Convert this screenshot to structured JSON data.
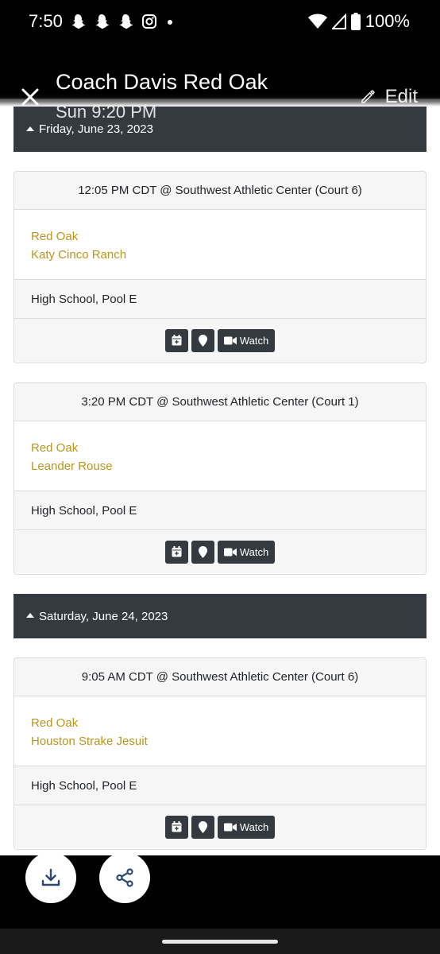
{
  "status_bar": {
    "time": "7:50",
    "battery": "100%"
  },
  "app_bar": {
    "title": "Coach Davis Red Oak",
    "subtitle": "Sun 9:20 PM",
    "edit_label": "Edit"
  },
  "days": [
    {
      "label": "Friday, June 23, 2023",
      "games": [
        {
          "time_location": "12:05 PM CDT @ Southwest Athletic Center (Court 6)",
          "team1": "Red Oak",
          "team2": "Katy Cinco Ranch",
          "division": "High School, Pool E",
          "watch_label": "Watch"
        },
        {
          "time_location": "3:20 PM CDT @ Southwest Athletic Center (Court 1)",
          "team1": "Red Oak",
          "team2": "Leander Rouse",
          "division": "High School, Pool E",
          "watch_label": "Watch"
        }
      ]
    },
    {
      "label": "Saturday, June 24, 2023",
      "games": [
        {
          "time_location": "9:05 AM CDT @ Southwest Athletic Center (Court 6)",
          "team1": "Red Oak",
          "team2": "Houston Strake Jesuit",
          "division": "High School, Pool E",
          "watch_label": "Watch"
        }
      ]
    }
  ],
  "colors": {
    "header_dark": "#343a40",
    "team_link": "#b8961e"
  },
  "icons": {
    "calendar": "calendar-add-icon",
    "location": "map-pin-icon",
    "watch": "video-camera-icon",
    "download": "download-icon",
    "share": "share-icon"
  }
}
